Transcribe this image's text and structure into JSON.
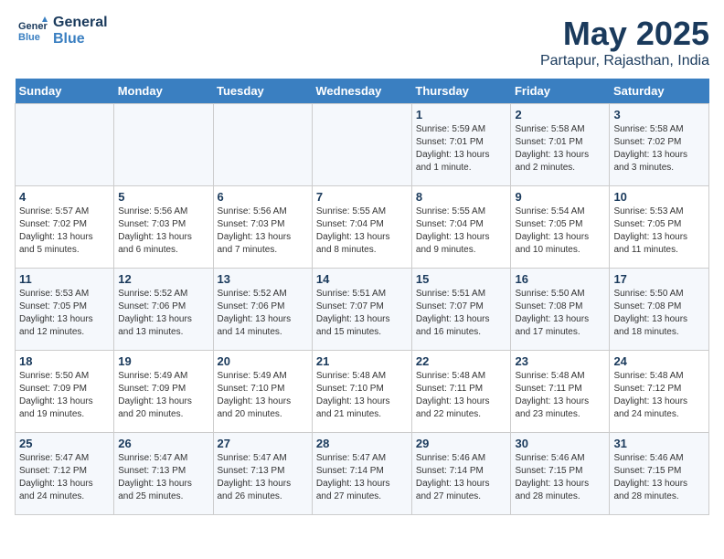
{
  "logo": {
    "line1": "General",
    "line2": "Blue"
  },
  "title": "May 2025",
  "subtitle": "Partapur, Rajasthan, India",
  "days_of_week": [
    "Sunday",
    "Monday",
    "Tuesday",
    "Wednesday",
    "Thursday",
    "Friday",
    "Saturday"
  ],
  "weeks": [
    [
      {
        "day": "",
        "info": ""
      },
      {
        "day": "",
        "info": ""
      },
      {
        "day": "",
        "info": ""
      },
      {
        "day": "",
        "info": ""
      },
      {
        "day": "1",
        "info": "Sunrise: 5:59 AM\nSunset: 7:01 PM\nDaylight: 13 hours and 1 minute."
      },
      {
        "day": "2",
        "info": "Sunrise: 5:58 AM\nSunset: 7:01 PM\nDaylight: 13 hours and 2 minutes."
      },
      {
        "day": "3",
        "info": "Sunrise: 5:58 AM\nSunset: 7:02 PM\nDaylight: 13 hours and 3 minutes."
      }
    ],
    [
      {
        "day": "4",
        "info": "Sunrise: 5:57 AM\nSunset: 7:02 PM\nDaylight: 13 hours and 5 minutes."
      },
      {
        "day": "5",
        "info": "Sunrise: 5:56 AM\nSunset: 7:03 PM\nDaylight: 13 hours and 6 minutes."
      },
      {
        "day": "6",
        "info": "Sunrise: 5:56 AM\nSunset: 7:03 PM\nDaylight: 13 hours and 7 minutes."
      },
      {
        "day": "7",
        "info": "Sunrise: 5:55 AM\nSunset: 7:04 PM\nDaylight: 13 hours and 8 minutes."
      },
      {
        "day": "8",
        "info": "Sunrise: 5:55 AM\nSunset: 7:04 PM\nDaylight: 13 hours and 9 minutes."
      },
      {
        "day": "9",
        "info": "Sunrise: 5:54 AM\nSunset: 7:05 PM\nDaylight: 13 hours and 10 minutes."
      },
      {
        "day": "10",
        "info": "Sunrise: 5:53 AM\nSunset: 7:05 PM\nDaylight: 13 hours and 11 minutes."
      }
    ],
    [
      {
        "day": "11",
        "info": "Sunrise: 5:53 AM\nSunset: 7:05 PM\nDaylight: 13 hours and 12 minutes."
      },
      {
        "day": "12",
        "info": "Sunrise: 5:52 AM\nSunset: 7:06 PM\nDaylight: 13 hours and 13 minutes."
      },
      {
        "day": "13",
        "info": "Sunrise: 5:52 AM\nSunset: 7:06 PM\nDaylight: 13 hours and 14 minutes."
      },
      {
        "day": "14",
        "info": "Sunrise: 5:51 AM\nSunset: 7:07 PM\nDaylight: 13 hours and 15 minutes."
      },
      {
        "day": "15",
        "info": "Sunrise: 5:51 AM\nSunset: 7:07 PM\nDaylight: 13 hours and 16 minutes."
      },
      {
        "day": "16",
        "info": "Sunrise: 5:50 AM\nSunset: 7:08 PM\nDaylight: 13 hours and 17 minutes."
      },
      {
        "day": "17",
        "info": "Sunrise: 5:50 AM\nSunset: 7:08 PM\nDaylight: 13 hours and 18 minutes."
      }
    ],
    [
      {
        "day": "18",
        "info": "Sunrise: 5:50 AM\nSunset: 7:09 PM\nDaylight: 13 hours and 19 minutes."
      },
      {
        "day": "19",
        "info": "Sunrise: 5:49 AM\nSunset: 7:09 PM\nDaylight: 13 hours and 20 minutes."
      },
      {
        "day": "20",
        "info": "Sunrise: 5:49 AM\nSunset: 7:10 PM\nDaylight: 13 hours and 20 minutes."
      },
      {
        "day": "21",
        "info": "Sunrise: 5:48 AM\nSunset: 7:10 PM\nDaylight: 13 hours and 21 minutes."
      },
      {
        "day": "22",
        "info": "Sunrise: 5:48 AM\nSunset: 7:11 PM\nDaylight: 13 hours and 22 minutes."
      },
      {
        "day": "23",
        "info": "Sunrise: 5:48 AM\nSunset: 7:11 PM\nDaylight: 13 hours and 23 minutes."
      },
      {
        "day": "24",
        "info": "Sunrise: 5:48 AM\nSunset: 7:12 PM\nDaylight: 13 hours and 24 minutes."
      }
    ],
    [
      {
        "day": "25",
        "info": "Sunrise: 5:47 AM\nSunset: 7:12 PM\nDaylight: 13 hours and 24 minutes."
      },
      {
        "day": "26",
        "info": "Sunrise: 5:47 AM\nSunset: 7:13 PM\nDaylight: 13 hours and 25 minutes."
      },
      {
        "day": "27",
        "info": "Sunrise: 5:47 AM\nSunset: 7:13 PM\nDaylight: 13 hours and 26 minutes."
      },
      {
        "day": "28",
        "info": "Sunrise: 5:47 AM\nSunset: 7:14 PM\nDaylight: 13 hours and 27 minutes."
      },
      {
        "day": "29",
        "info": "Sunrise: 5:46 AM\nSunset: 7:14 PM\nDaylight: 13 hours and 27 minutes."
      },
      {
        "day": "30",
        "info": "Sunrise: 5:46 AM\nSunset: 7:15 PM\nDaylight: 13 hours and 28 minutes."
      },
      {
        "day": "31",
        "info": "Sunrise: 5:46 AM\nSunset: 7:15 PM\nDaylight: 13 hours and 28 minutes."
      }
    ]
  ]
}
